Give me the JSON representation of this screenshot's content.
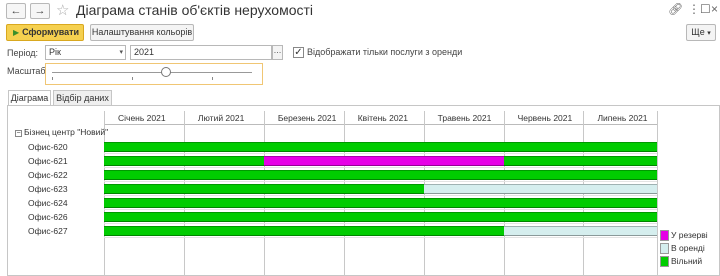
{
  "window": {
    "title": "Діаграма станів об'єктів нерухомості",
    "icons": [
      "link-icon",
      "more-vertical-icon",
      "maximize-icon",
      "close-icon"
    ]
  },
  "toolbar": {
    "generate_label": "Сформувати",
    "colors_label": "Налаштування кольорів",
    "more_label": "Ще"
  },
  "filters": {
    "period_label": "Період:",
    "period_type": "Рік",
    "period_value": "2021",
    "rent_only_label": "Відображати тільки послуги з оренди",
    "rent_only_checked": true,
    "scale_label": "Масштаб:",
    "scale_value": 0.57
  },
  "tabs": [
    {
      "label": "Діаграма",
      "active": true
    },
    {
      "label": "Відбір даних",
      "active": false
    }
  ],
  "chart": {
    "months": [
      "Січень 2021",
      "Лютий 2021",
      "Березень 2021",
      "Квітень 2021",
      "Травень 2021",
      "Червень 2021",
      "Липень 2021"
    ],
    "group": "Бізнец центр \"Новий\"",
    "rows": [
      {
        "name": "Офис-620",
        "segments": [
          {
            "status": "free",
            "from": 0,
            "to": 7
          }
        ]
      },
      {
        "name": "Офис-621",
        "segments": [
          {
            "status": "free",
            "from": 0,
            "to": 2
          },
          {
            "status": "reserved",
            "from": 2,
            "to": 5
          },
          {
            "status": "free",
            "from": 5,
            "to": 7
          }
        ]
      },
      {
        "name": "Офис-622",
        "segments": [
          {
            "status": "free",
            "from": 0,
            "to": 7
          }
        ]
      },
      {
        "name": "Офис-623",
        "segments": [
          {
            "status": "free",
            "from": 0,
            "to": 4
          },
          {
            "status": "rented",
            "from": 4,
            "to": 7
          }
        ]
      },
      {
        "name": "Офис-624",
        "segments": [
          {
            "status": "free",
            "from": 0,
            "to": 7
          }
        ]
      },
      {
        "name": "Офис-626",
        "segments": [
          {
            "status": "free",
            "from": 0,
            "to": 7
          }
        ]
      },
      {
        "name": "Офис-627",
        "segments": [
          {
            "status": "free",
            "from": 0,
            "to": 5
          },
          {
            "status": "rented",
            "from": 5,
            "to": 7
          }
        ]
      }
    ],
    "colors": {
      "free": "#00cc00",
      "reserved": "#e600e6",
      "rented": "#d5eeee"
    },
    "legend": [
      {
        "status": "reserved",
        "label": "У резерві"
      },
      {
        "status": "rented",
        "label": "В оренді"
      },
      {
        "status": "free",
        "label": "Вільний"
      }
    ]
  }
}
